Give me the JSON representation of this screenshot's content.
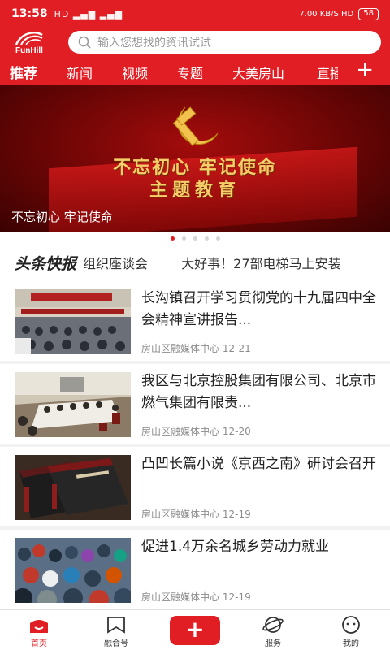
{
  "status_bar": {
    "time": "13:58",
    "signal": "HD ▂▄▆ ▂▄▆",
    "network": "7.00 KB/S HD",
    "battery": "58"
  },
  "header": {
    "logo_text": "FunHill",
    "search_placeholder": "输入您想找的资讯试试"
  },
  "tabs": [
    "推荐",
    "新闻",
    "视频",
    "专题",
    "大美房山",
    "直播"
  ],
  "tabs_more_label": "+",
  "banner": {
    "title_line1": "不忘初心 牢记使命",
    "title_line2": "主题教育",
    "caption": "不忘初心 牢记使命",
    "slide_count": 5,
    "active_slide": 0
  },
  "flash": {
    "label_a": "头条",
    "label_b": "快报",
    "items": [
      "组织座谈会",
      "大好事！27部电梯马上安装"
    ]
  },
  "news": [
    {
      "title": "长沟镇召开学习贯彻党的十九届四中全会精神宣讲报告...",
      "source": "房山区融媒体中心",
      "date": "12-21"
    },
    {
      "title": "我区与北京控股集团有限公司、北京市燃气集团有限责...",
      "source": "房山区融媒体中心",
      "date": "12-20"
    },
    {
      "title": "凸凹长篇小说《京西之南》研讨会召开",
      "source": "房山区融媒体中心",
      "date": "12-19"
    },
    {
      "title": "促进1.4万余名城乡劳动力就业",
      "source": "房山区融媒体中心",
      "date": "12-19"
    }
  ],
  "bottom_nav": {
    "home": "首页",
    "media": "融合号",
    "add": "+",
    "service": "服务",
    "mine": "我的"
  },
  "colors": {
    "brand": "#e01e24"
  }
}
